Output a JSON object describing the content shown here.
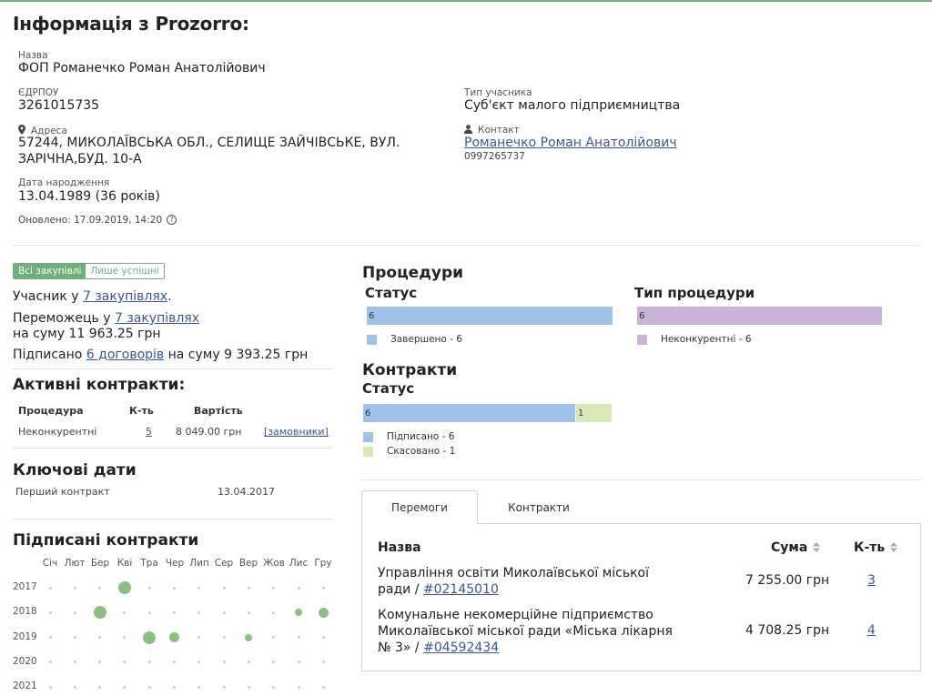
{
  "page": {
    "title": "Інформація з Prozorro:"
  },
  "info": {
    "name_label": "Назва",
    "name": "ФОП Романечко Роман Анатолійович",
    "edrpou_label": "ЄДРПОУ",
    "edrpou": "3261015735",
    "participant_type_label": "Тип учасника",
    "participant_type": "Суб'єкт малого підприємництва",
    "address_label": "Адреса",
    "address_line1": "57244, МИКОЛАЇВСЬКА ОБЛ., СЕЛИЩЕ ЗАЙЧІВСЬКЕ, ВУЛ.",
    "address_line2": "ЗАРІЧНА,БУД. 10-А",
    "contact_label": "Контакт",
    "contact_name": "Романечко Роман Анатолійович",
    "contact_phone": "0997265737",
    "birth_label": "Дата народження",
    "birth": "13.04.1989 (36 років)",
    "updated": "Оновлено: 17.09.2019, 14:20",
    "help": "?"
  },
  "filter": {
    "all": "Всі закупівлі",
    "successful": "Лише успішні"
  },
  "summary": {
    "participant_prefix": "Учасник у ",
    "participant_link": "7 закупівлях",
    "participant_suffix": ".",
    "winner_prefix": "Переможець у ",
    "winner_link": "7 закупівлях",
    "winner_sum": "на суму 11 963.25 грн",
    "signed_prefix": "Підписано ",
    "signed_link": "6 договорів",
    "signed_suffix": " на суму 9 393.25 грн"
  },
  "active_contracts": {
    "title": "Активні контракти:",
    "headers": [
      "Процедура",
      "К-ть",
      "Вартість"
    ],
    "row": {
      "procedure": "Неконкурентні",
      "count": "5",
      "value": "8 049.00 грн",
      "customers_link": "[замовники]"
    }
  },
  "key_dates": {
    "title": "Ключові дати",
    "first_contract_label": "Перший контракт",
    "first_contract_date": "13.04.2017"
  },
  "signed_contracts": {
    "title": "Підписані контракти",
    "months": [
      "Січ",
      "Лют",
      "Бер",
      "Кві",
      "Тра",
      "Чер",
      "Лип",
      "Сер",
      "Вер",
      "Жов",
      "Лис",
      "Гру"
    ],
    "years": [
      "2017",
      "2018",
      "2019",
      "2020",
      "2021"
    ],
    "marks": [
      {
        "year": "2017",
        "month": 3,
        "size": "large"
      },
      {
        "year": "2018",
        "month": 2,
        "size": "large"
      },
      {
        "year": "2018",
        "month": 10,
        "size": "small"
      },
      {
        "year": "2018",
        "month": 11,
        "size": "medium"
      },
      {
        "year": "2019",
        "month": 4,
        "size": "large"
      },
      {
        "year": "2019",
        "month": 5,
        "size": "medium"
      },
      {
        "year": "2019",
        "month": 8,
        "size": "small"
      }
    ]
  },
  "procedures": {
    "title": "Процедури",
    "status_title": "Статус",
    "type_title": "Тип процедури"
  },
  "contracts": {
    "title": "Контракти",
    "status_title": "Статус"
  },
  "chart_data": [
    {
      "type": "bar",
      "title": "Статус",
      "series": [
        {
          "name": "Завершено",
          "values": [
            6
          ]
        }
      ],
      "legend": [
        "Завершено - 6"
      ],
      "colors": [
        "#9fc2ea"
      ]
    },
    {
      "type": "bar",
      "title": "Тип процедури",
      "series": [
        {
          "name": "Неконкурентні",
          "values": [
            6
          ]
        }
      ],
      "legend": [
        "Неконкурентні - 6"
      ],
      "colors": [
        "#c9b2d8"
      ]
    },
    {
      "type": "bar",
      "title": "Статус",
      "series": [
        {
          "name": "Підписано",
          "values": [
            6
          ]
        },
        {
          "name": "Скасовано",
          "values": [
            1
          ]
        }
      ],
      "legend": [
        "Підписано - 6",
        "Скасовано - 1"
      ],
      "colors": [
        "#9fc2ea",
        "#d8e8b3"
      ]
    }
  ],
  "tabs": {
    "wins": "Перемоги",
    "contracts": "Контракти"
  },
  "wins_table": {
    "headers": {
      "name": "Назва",
      "sum": "Сума",
      "count": "К-ть"
    },
    "rows": [
      {
        "line1": "Управління освіти Миколаївської міської",
        "line2_prefix": "ради / ",
        "code": "#02145010",
        "sum": "7 255.00 грн",
        "count": "3"
      },
      {
        "line1": "Комунальне некомерційне підприємство",
        "line2": "Миколаївської міської ради «Міська лікарня",
        "line3_prefix": "№ 3» / ",
        "code": "#04592434",
        "sum": "4 708.25 грн",
        "count": "4"
      }
    ]
  },
  "colors": {
    "accent_green": "#6fb07a",
    "link_blue": "#3a55a5",
    "bar_blue": "#9fc2ea",
    "bar_purple": "#c9b2d8",
    "bar_lightgreen": "#d8e8b3",
    "dot_green": "#8bbf80"
  }
}
